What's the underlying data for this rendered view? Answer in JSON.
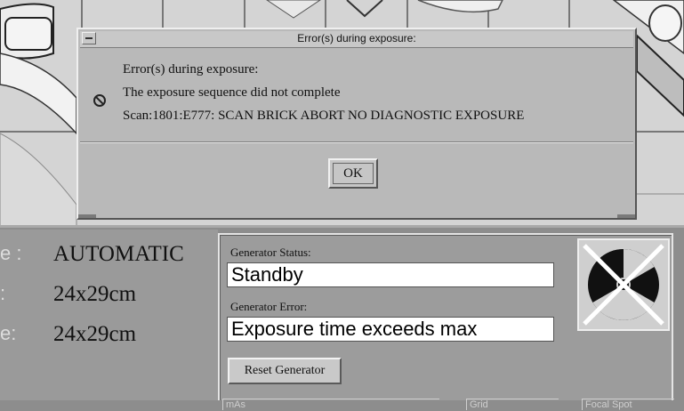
{
  "dialog": {
    "title": "Error(s) during exposure:",
    "messages": [
      "Error(s) during exposure:",
      "The exposure sequence did not complete",
      "Scan:1801:E777: SCAN BRICK ABORT NO DIAGNOSTIC EXPOSURE"
    ],
    "ok_label": "OK",
    "icon": "prohibited-icon"
  },
  "mode_panel": {
    "rows": [
      {
        "partial_label": "e :",
        "value": "AUTOMATIC"
      },
      {
        "partial_label": ":",
        "value": "24x29cm"
      },
      {
        "partial_label": "e:",
        "value": "24x29cm"
      }
    ]
  },
  "generator": {
    "status_label": "Generator Status:",
    "status_value": "Standby",
    "error_label": "Generator Error:",
    "error_value": "Exposure time exceeds max",
    "reset_label": "Reset Generator",
    "status_icon": "radiation-disabled-icon"
  },
  "footer": {
    "labels": [
      "mAs",
      "Grid",
      "Focal Spot"
    ]
  },
  "colors": {
    "background": "#8d8d8d",
    "dialog": "#b9b9b9",
    "field": "#ffffff"
  }
}
